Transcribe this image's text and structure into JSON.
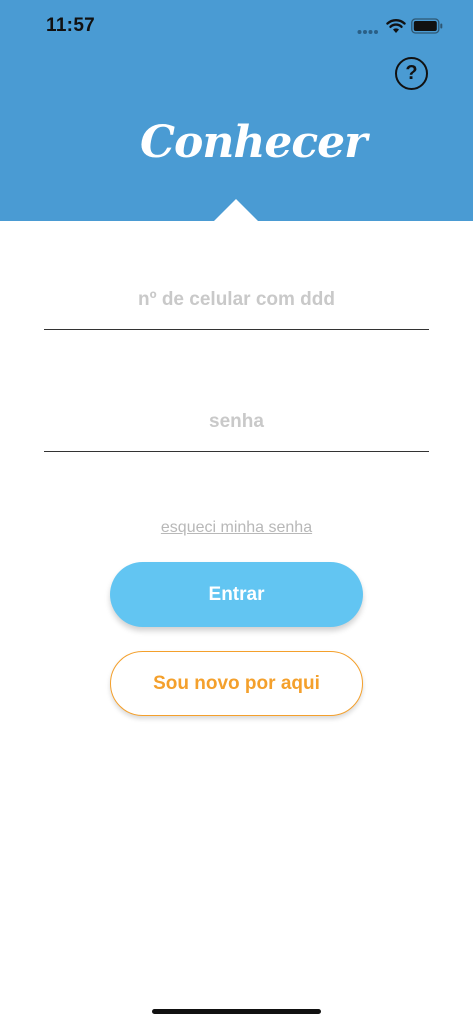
{
  "status_bar": {
    "time": "11:57",
    "icons": [
      "signal-icon",
      "wifi-icon",
      "battery-icon"
    ]
  },
  "header": {
    "background_color": "#4a9bd3",
    "logo_text": "Conhecer",
    "help_label": "?"
  },
  "form": {
    "phone_placeholder": "nº de celular com ddd",
    "password_placeholder": "senha",
    "forgot_password": "esqueci minha senha"
  },
  "buttons": {
    "login_label": "Entrar",
    "login_color": "#62c5f2",
    "signup_label": "Sou novo por aqui",
    "signup_color": "#f4a02c"
  }
}
